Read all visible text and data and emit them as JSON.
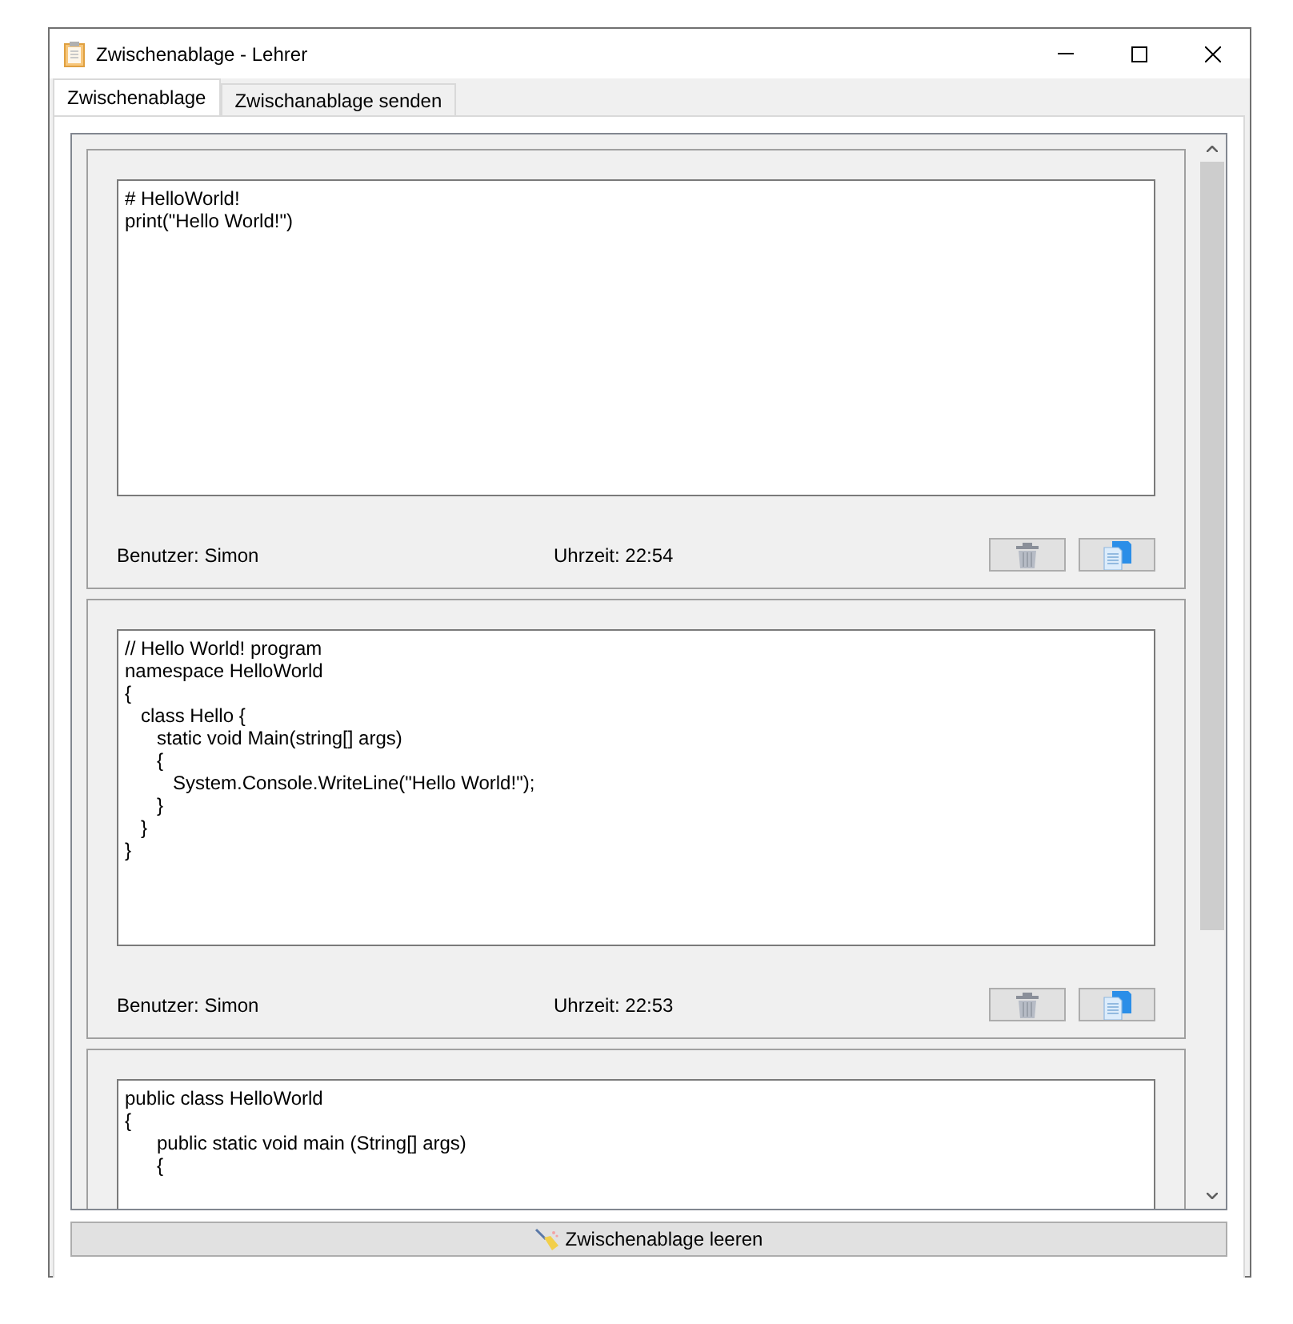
{
  "window": {
    "title": "Zwischenablage - Lehrer"
  },
  "tabs": [
    {
      "label": "Zwischenablage",
      "selected": true
    },
    {
      "label": "Zwischanablage senden",
      "selected": false
    }
  ],
  "entries": [
    {
      "code": [
        "# HelloWorld!",
        "print(\"Hello World!\")"
      ],
      "user": "Benutzer: Simon",
      "time": "Uhrzeit: 22:54"
    },
    {
      "code": [
        "// Hello World! program",
        "namespace HelloWorld",
        "{",
        "   class Hello {",
        "      static void Main(string[] args)",
        "      {",
        "         System.Console.WriteLine(\"Hello World!\");",
        "      }",
        "   }",
        "}"
      ],
      "user": "Benutzer: Simon",
      "time": "Uhrzeit: 22:53"
    },
    {
      "code": [
        "public class HelloWorld",
        "{",
        "      public static void main (String[] args)",
        "      {"
      ]
    }
  ],
  "clear_button": {
    "label": "Zwischenablage leeren"
  }
}
